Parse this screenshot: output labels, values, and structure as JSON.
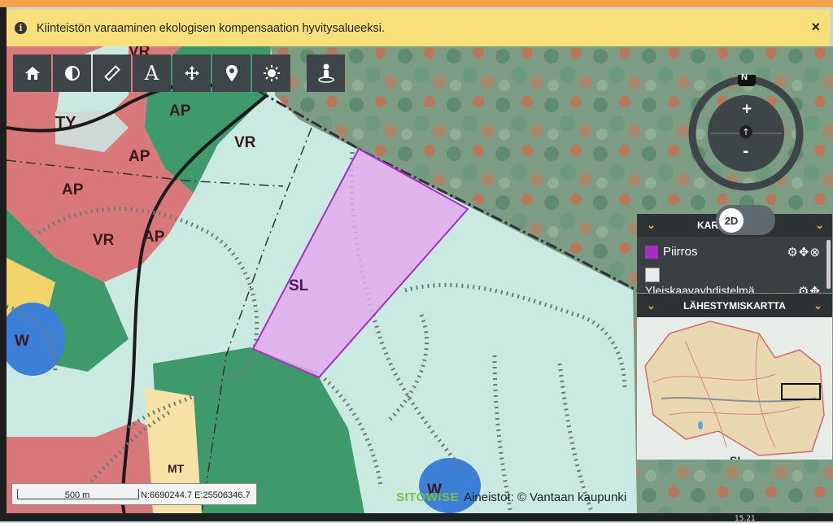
{
  "banner": {
    "message": "Kiinteistön varaaminen ekologisen kompensaation hyvitysalueeksi.",
    "info_glyph": "i",
    "close_glyph": "×"
  },
  "toolbar": {
    "icons": [
      "home-icon",
      "contrast-icon",
      "ruler-icon",
      "text-icon",
      "move-icon",
      "location-pin-icon",
      "sun-icon",
      "street-view-icon"
    ],
    "text_tool_label": "A"
  },
  "compass": {
    "north_label": "N",
    "zoom_in": "+",
    "zoom_out": "-",
    "up_arrow": "↑"
  },
  "map_labels": {
    "vr_top": "VR",
    "ty": "TY",
    "ap1": "AP",
    "ap2": "AP",
    "ap3": "AP",
    "ap4": "AP",
    "vr_mid": "VR",
    "vr_left": "VR",
    "sl_main": "SL",
    "w_left": "W",
    "w_bottom": "W",
    "mt": "MT",
    "sl_corner": "SL"
  },
  "layers_panel": {
    "title": "KARTTATASOT",
    "title_visible": "KAR",
    "toggle_label": "2D",
    "chevron": "⌄",
    "layers": [
      {
        "name": "Piirros",
        "color": "#a42fc2"
      },
      {
        "name": "Yleiskaavayhdistelmä"
      }
    ]
  },
  "overview_panel": {
    "title": "LÄHESTYMISKARTTA"
  },
  "scale": {
    "label": "500 m",
    "coordinates": "N:6690244.7 E:25506346.7"
  },
  "attribution": {
    "brand": "SITOWISE",
    "text": "Aineistot: © Vantaan kaupunki"
  },
  "taskbar": {
    "time": "15.21"
  },
  "colors": {
    "banner": "#f8df79",
    "toolbar": "#3d4549",
    "drawing": "#a42fc2",
    "zone_ap": "#d9787a",
    "zone_vr": "#3f9a6b",
    "zone_sl": "#c9e9e1",
    "water": "#3b7fd6"
  }
}
